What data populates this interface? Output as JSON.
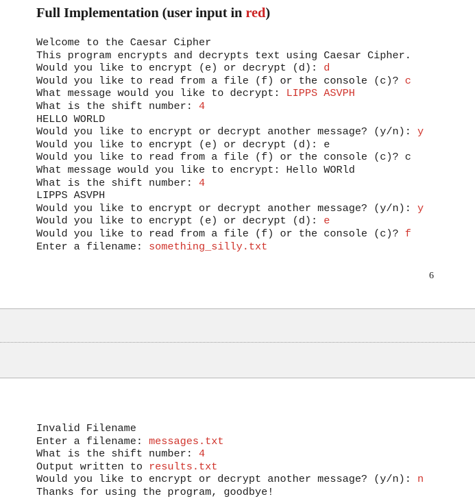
{
  "document": {
    "title_plain_before": "Full Implementation (user input in ",
    "title_accent": "red",
    "title_plain_after": ")",
    "page_number": "6"
  },
  "colors": {
    "user_input_red": "#d0342c",
    "text_black": "#1d1d1d",
    "page_gap_background": "#f1f1f1",
    "page_gap_border": "#b8b8b8"
  },
  "console_top": {
    "lines": [
      {
        "prompt": "Welcome to the Caesar Cipher",
        "input": ""
      },
      {
        "prompt": "This program encrypts and decrypts text using Caesar Cipher.",
        "input": ""
      },
      {
        "prompt": "Would you like to encrypt (e) or decrypt (d): ",
        "input": "d",
        "input_red": true
      },
      {
        "prompt": "Would you like to read from a file (f) or the console (c)? ",
        "input": "c",
        "input_red": true
      },
      {
        "prompt": "What message would you like to decrypt: ",
        "input": "LIPPS ASVPH",
        "input_red": true
      },
      {
        "prompt": "What is the shift number: ",
        "input": "4",
        "input_red": true
      },
      {
        "prompt": "HELLO WORLD",
        "input": ""
      },
      {
        "prompt": "Would you like to encrypt or decrypt another message? (y/n): ",
        "input": "y",
        "input_red": true
      },
      {
        "prompt": "Would you like to encrypt (e) or decrypt (d): e",
        "input": ""
      },
      {
        "prompt": "Would you like to read from a file (f) or the console (c)? c",
        "input": ""
      },
      {
        "prompt": "What message would you like to encrypt: Hello WORld",
        "input": ""
      },
      {
        "prompt": "What is the shift number: ",
        "input": "4",
        "input_red": true
      },
      {
        "prompt": "LIPPS ASVPH",
        "input": ""
      },
      {
        "prompt": "Would you like to encrypt or decrypt another message? (y/n): ",
        "input": "y",
        "input_red": true
      },
      {
        "prompt": "Would you like to encrypt (e) or decrypt (d): ",
        "input": "e",
        "input_red": true
      },
      {
        "prompt": "Would you like to read from a file (f) or the console (c)? ",
        "input": "f",
        "input_red": true
      },
      {
        "prompt": "Enter a filename: ",
        "input": "something_silly.txt",
        "input_red": true
      }
    ]
  },
  "console_bottom": {
    "lines": [
      {
        "prompt": "Invalid Filename",
        "input": ""
      },
      {
        "prompt": "Enter a filename: ",
        "input": "messages.txt",
        "input_red": true
      },
      {
        "prompt": "What is the shift number: ",
        "input": "4",
        "input_red": true
      },
      {
        "prompt": "Output written to ",
        "input": "results.txt",
        "input_red": true
      },
      {
        "prompt": "Would you like to encrypt or decrypt another message? (y/n): ",
        "input": "n",
        "input_red": true
      },
      {
        "prompt": "Thanks for using the program, goodbye!",
        "input": ""
      }
    ]
  }
}
